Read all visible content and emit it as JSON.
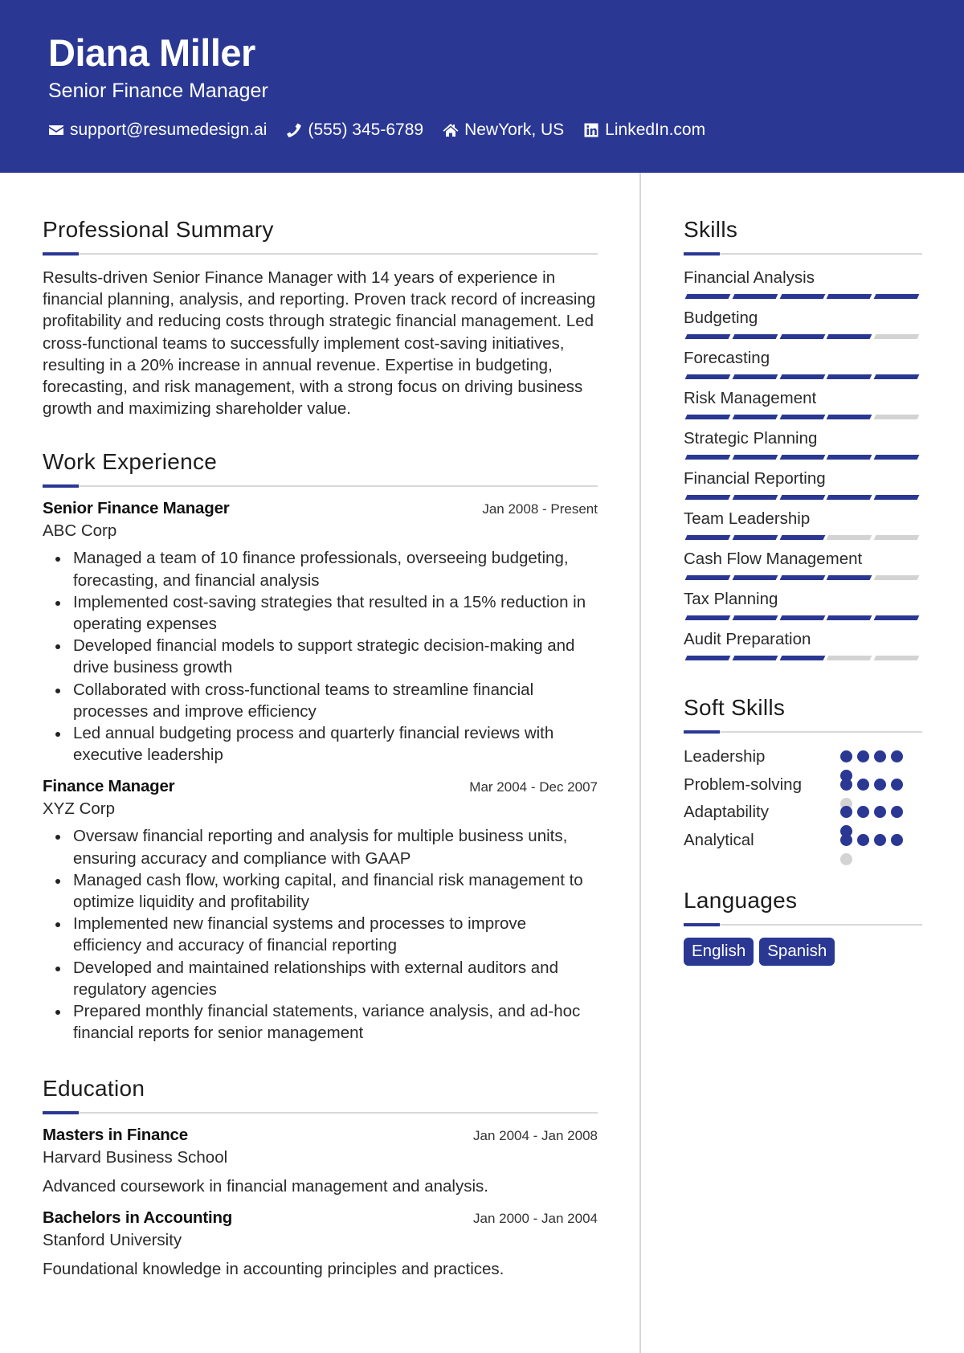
{
  "header": {
    "name": "Diana Miller",
    "title": "Senior Finance Manager",
    "contacts": [
      {
        "icon": "envelope-icon",
        "text": "support@resumedesign.ai"
      },
      {
        "icon": "phone-icon",
        "text": "(555) 345-6789"
      },
      {
        "icon": "home-icon",
        "text": "NewYork, US"
      },
      {
        "icon": "linkedin-icon",
        "text": "LinkedIn.com"
      }
    ]
  },
  "colors": {
    "accent": "#2a3893",
    "inactive": "#d3d3d3",
    "rule": "#d9d9d9"
  },
  "summary": {
    "heading": "Professional Summary",
    "text": "Results-driven Senior Finance Manager with 14 years of experience in financial planning, analysis, and reporting. Proven track record of increasing profitability and reducing costs through strategic financial management. Led cross-functional teams to successfully implement cost-saving initiatives, resulting in a 20% increase in annual revenue. Expertise in budgeting, forecasting, and risk management, with a strong focus on driving business growth and maximizing shareholder value."
  },
  "experience": {
    "heading": "Work Experience",
    "jobs": [
      {
        "title": "Senior Finance Manager",
        "dates": "Jan 2008 - Present",
        "company": "ABC Corp",
        "bullets": [
          "Managed a team of 10 finance professionals, overseeing budgeting, forecasting, and financial analysis",
          "Implemented cost-saving strategies that resulted in a 15% reduction in operating expenses",
          "Developed financial models to support strategic decision-making and drive business growth",
          "Collaborated with cross-functional teams to streamline financial processes and improve efficiency",
          "Led annual budgeting process and quarterly financial reviews with executive leadership"
        ]
      },
      {
        "title": "Finance Manager",
        "dates": "Mar 2004 - Dec 2007",
        "company": "XYZ Corp",
        "bullets": [
          "Oversaw financial reporting and analysis for multiple business units, ensuring accuracy and compliance with GAAP",
          "Managed cash flow, working capital, and financial risk management to optimize liquidity and profitability",
          "Implemented new financial systems and processes to improve efficiency and accuracy of financial reporting",
          "Developed and maintained relationships with external auditors and regulatory agencies",
          "Prepared monthly financial statements, variance analysis, and ad-hoc financial reports for senior management"
        ]
      }
    ]
  },
  "education": {
    "heading": "Education",
    "items": [
      {
        "degree": "Masters in Finance",
        "dates": "Jan 2004 - Jan 2008",
        "school": "Harvard Business School",
        "description": "Advanced coursework in financial management and analysis."
      },
      {
        "degree": "Bachelors in Accounting",
        "dates": "Jan 2000 - Jan 2004",
        "school": "Stanford University",
        "description": "Foundational knowledge in accounting principles and practices."
      }
    ]
  },
  "skills": {
    "heading": "Skills",
    "max_rating": 5,
    "items": [
      {
        "name": "Financial Analysis",
        "rating": 5
      },
      {
        "name": "Budgeting",
        "rating": 4
      },
      {
        "name": "Forecasting",
        "rating": 5
      },
      {
        "name": "Risk Management",
        "rating": 4
      },
      {
        "name": "Strategic Planning",
        "rating": 5
      },
      {
        "name": "Financial Reporting",
        "rating": 5
      },
      {
        "name": "Team Leadership",
        "rating": 3
      },
      {
        "name": "Cash Flow Management",
        "rating": 4
      },
      {
        "name": "Tax Planning",
        "rating": 5
      },
      {
        "name": "Audit Preparation",
        "rating": 3
      }
    ]
  },
  "soft_skills": {
    "heading": "Soft Skills",
    "max_rating": 5,
    "items": [
      {
        "name": "Leadership",
        "rating": 5
      },
      {
        "name": "Problem-solving",
        "rating": 4
      },
      {
        "name": "Adaptability",
        "rating": 5
      },
      {
        "name": "Analytical",
        "rating": 4
      }
    ]
  },
  "languages": {
    "heading": "Languages",
    "items": [
      "English",
      "Spanish"
    ]
  }
}
